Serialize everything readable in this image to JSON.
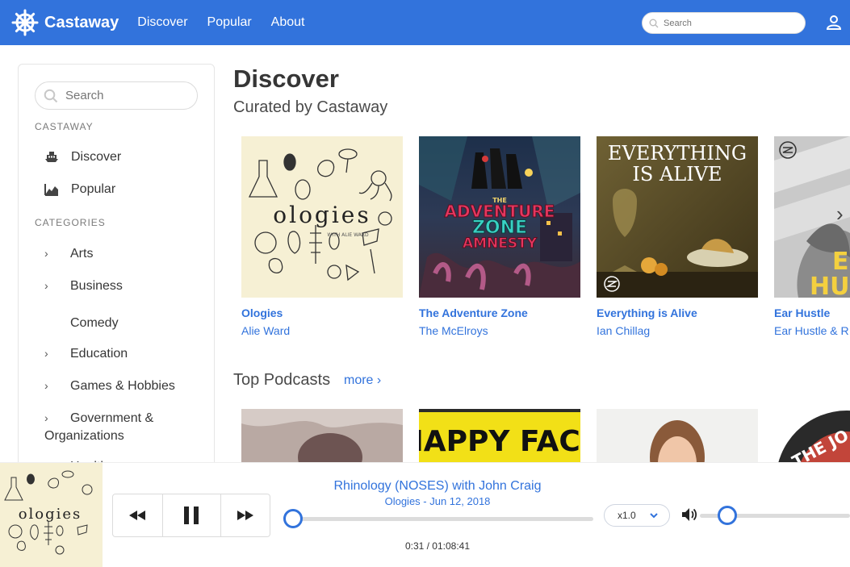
{
  "app": {
    "name": "Castaway",
    "accent": "#3273dc"
  },
  "nav": {
    "links": [
      "Discover",
      "Popular",
      "About"
    ],
    "search_placeholder": "Search"
  },
  "sidebar": {
    "search_placeholder": "Search",
    "section_label": "CASTAWAY",
    "items": [
      {
        "label": "Discover",
        "icon": "ship-icon"
      },
      {
        "label": "Popular",
        "icon": "chart-icon"
      }
    ],
    "categories_label": "CATEGORIES",
    "categories": [
      "Arts",
      "Business",
      "Comedy",
      "Education",
      "Games & Hobbies",
      "Government &",
      "Organizations",
      "Health"
    ]
  },
  "main": {
    "title": "Discover",
    "subtitle": "Curated by Castaway",
    "curated": [
      {
        "title": "Ologies",
        "author": "Alie Ward"
      },
      {
        "title": "The Adventure Zone",
        "author": "The McElroys"
      },
      {
        "title": "Everything is Alive",
        "author": "Ian Chillag"
      },
      {
        "title": "Ear Hustle",
        "author": "Ear Hustle & R"
      }
    ],
    "covers": {
      "ologies": "ologies",
      "ologies_sub": "WITH ALIE WARD",
      "adventure_top": "THE",
      "adventure_line1": "ADVENTURE",
      "adventure_line2": "ZONE",
      "adventure_line3": "AMNESTY",
      "everything_line1": "EVERYTHING",
      "everything_line2": "IS ALIVE",
      "ear_line1": "E",
      "ear_line2": "HU",
      "happy_face": "HAPPY FACE",
      "joe": "THE JO"
    },
    "top_title": "Top Podcasts",
    "more_label": "more ›"
  },
  "player": {
    "episode_title": "Rhinology (NOSES) with John Craig",
    "episode_meta": "Ologies - Jun 12, 2018",
    "time": "0:31 / 01:08:41",
    "speed": "x1.0",
    "progress": 0.0075,
    "volume": 0.14
  }
}
